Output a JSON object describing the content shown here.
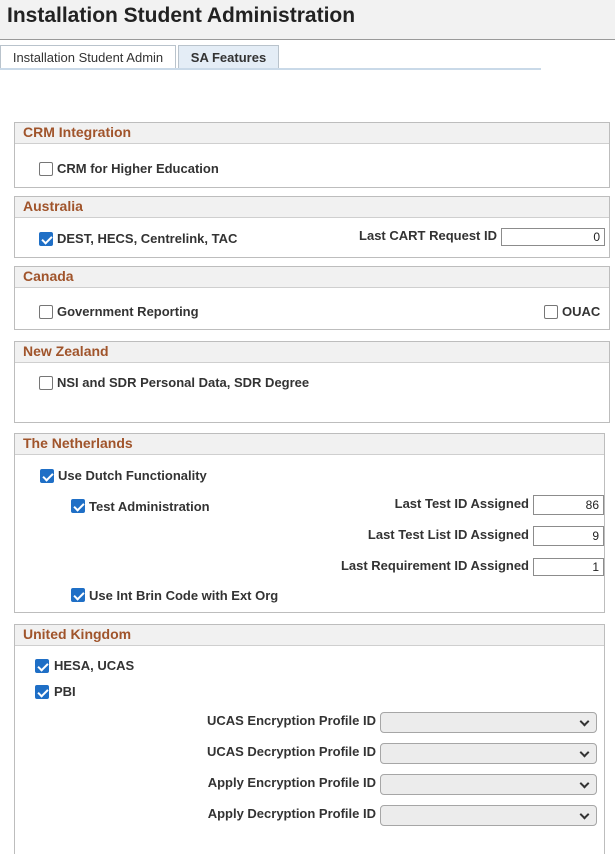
{
  "page": {
    "title": "Installation Student Administration"
  },
  "tabs": [
    {
      "label": "Installation Student Admin"
    },
    {
      "label": "SA Features"
    }
  ],
  "sections": {
    "crm": {
      "title": "CRM Integration",
      "crm_higher_ed": {
        "label": "CRM for Higher Education",
        "checked": false
      }
    },
    "australia": {
      "title": "Australia",
      "dest": {
        "label": "DEST, HECS, Centrelink, TAC",
        "checked": true
      },
      "last_cart_label": "Last CART Request ID",
      "last_cart_value": "0"
    },
    "canada": {
      "title": "Canada",
      "gov_reporting": {
        "label": "Government Reporting",
        "checked": false
      },
      "ouac": {
        "label": "OUAC",
        "checked": false
      }
    },
    "new_zealand": {
      "title": "New Zealand",
      "nsi": {
        "label": "NSI and SDR Personal Data, SDR Degree",
        "checked": false
      }
    },
    "netherlands": {
      "title": "The Netherlands",
      "dutch": {
        "label": "Use Dutch Functionality",
        "checked": true
      },
      "test_admin": {
        "label": "Test Administration",
        "checked": true
      },
      "last_test_label": "Last Test ID Assigned",
      "last_test_value": "86",
      "last_test_list_label": "Last Test List ID Assigned",
      "last_test_list_value": "9",
      "last_req_label": "Last Requirement ID Assigned",
      "last_req_value": "1",
      "brin": {
        "label": "Use Int Brin Code with Ext Org",
        "checked": true
      }
    },
    "uk": {
      "title": "United Kingdom",
      "hesa": {
        "label": "HESA, UCAS",
        "checked": true
      },
      "pbi": {
        "label": "PBI",
        "checked": true
      },
      "ucas_enc_label": "UCAS Encryption Profile ID",
      "ucas_dec_label": "UCAS Decryption Profile ID",
      "apply_enc_label": "Apply Encryption Profile ID",
      "apply_dec_label": "Apply Decryption Profile ID",
      "ucas_enc_value": "",
      "ucas_dec_value": "",
      "apply_enc_value": "",
      "apply_dec_value": ""
    }
  },
  "icons": {
    "checkbox": "checkbox-icon",
    "dropdown": "chevron-down-icon"
  },
  "colors": {
    "section_title": "#a0542b",
    "checkbox_checked": "#1f6fc6",
    "active_tab": "#e4edf6"
  }
}
